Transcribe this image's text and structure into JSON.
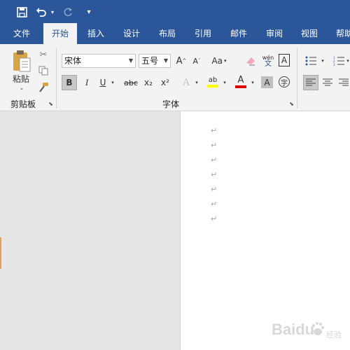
{
  "quick_access": {
    "save_icon": "save-icon",
    "undo_icon": "undo-icon",
    "redo_icon": "redo-icon",
    "customize_icon": "customize-quick-access-icon"
  },
  "tabs": [
    {
      "label": "文件",
      "active": false
    },
    {
      "label": "开始",
      "active": true
    },
    {
      "label": "插入",
      "active": false
    },
    {
      "label": "设计",
      "active": false
    },
    {
      "label": "布局",
      "active": false
    },
    {
      "label": "引用",
      "active": false
    },
    {
      "label": "邮件",
      "active": false
    },
    {
      "label": "审阅",
      "active": false
    },
    {
      "label": "视图",
      "active": false
    },
    {
      "label": "帮助",
      "active": false
    }
  ],
  "clipboard": {
    "paste_label": "粘贴",
    "group_label": "剪贴板"
  },
  "font": {
    "font_name": "宋体",
    "font_size": "五号",
    "change_case_label": "Aa",
    "phonetic_top": "wén",
    "phonetic_bottom": "文",
    "group_label": "字体",
    "bold_label": "B",
    "italic_label": "I",
    "underline_label": "U",
    "strike_label": "abc",
    "sub_label": "x₂",
    "sup_label": "x²",
    "highlight_color": "#ffff00",
    "font_color": "#e00000"
  },
  "document": {
    "paragraph_marks": [
      "↵",
      "↵",
      "↵",
      "↵",
      "↵",
      "↵",
      "↵"
    ]
  },
  "watermark": {
    "brand_text": "Baidu",
    "sub_text": "经验"
  },
  "colors": {
    "ribbon_blue": "#2b579a",
    "ribbon_bg": "#f3f3f3",
    "page_bg": "#ffffff",
    "canvas_bg": "#e6e6e6"
  }
}
